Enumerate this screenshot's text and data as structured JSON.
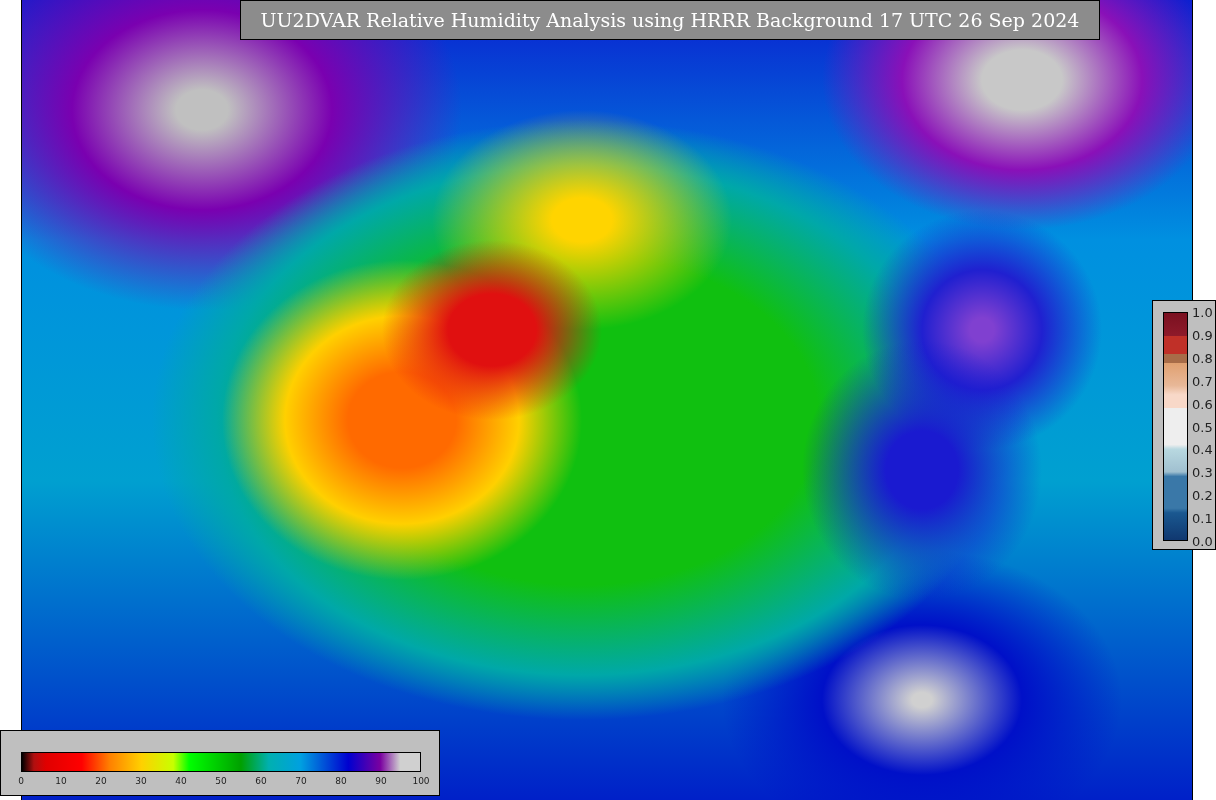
{
  "title": "UU2DVAR Relative Humidity Analysis using HRRR Background 17 UTC 26 Sep 2024",
  "humidity_colorbar": {
    "ticks": [
      "0",
      "10",
      "20",
      "30",
      "40",
      "50",
      "60",
      "70",
      "80",
      "90",
      "100"
    ]
  },
  "station_colorbar": {
    "ticks": [
      "1.0",
      "0.9",
      "0.8",
      "0.7",
      "0.6",
      "0.5",
      "0.4",
      "0.3",
      "0.2",
      "0.1",
      "0.0"
    ]
  }
}
